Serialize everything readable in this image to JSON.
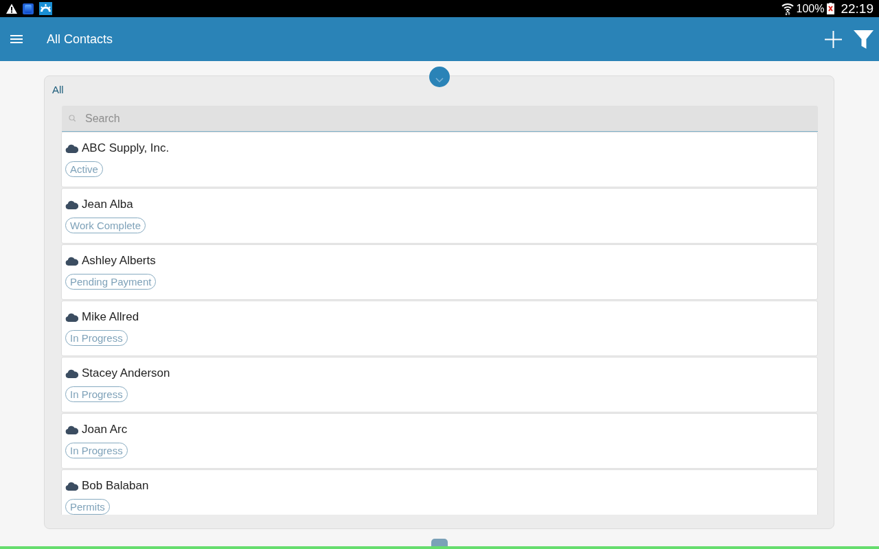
{
  "status_bar": {
    "battery": "100%",
    "time": "22:19"
  },
  "app_bar": {
    "title": "All Contacts"
  },
  "filter": {
    "label": "All"
  },
  "search": {
    "placeholder": "Search"
  },
  "contacts": [
    {
      "name": "ABC Supply, Inc.",
      "status": "Active"
    },
    {
      "name": "Jean Alba",
      "status": "Work Complete"
    },
    {
      "name": "Ashley Alberts",
      "status": "Pending Payment"
    },
    {
      "name": "Mike Allred",
      "status": "In Progress"
    },
    {
      "name": "Stacey Anderson",
      "status": "In Progress"
    },
    {
      "name": "Joan Arc",
      "status": "In Progress"
    },
    {
      "name": "Bob Balaban",
      "status": "Permits"
    }
  ]
}
